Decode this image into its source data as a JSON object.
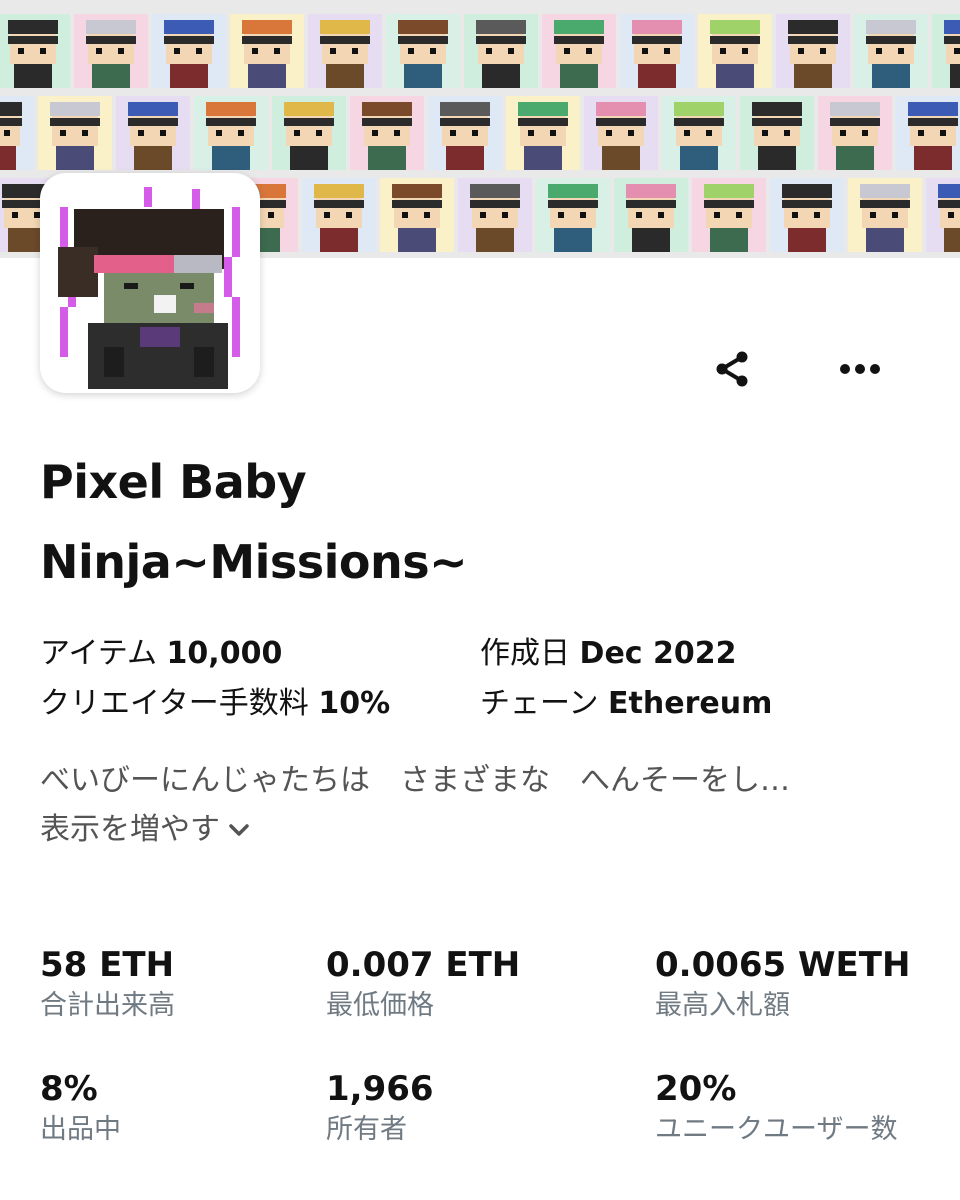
{
  "collection": {
    "title_line1": "Pixel Baby",
    "title_line2": "Ninja~Missions~"
  },
  "actions": {
    "share_icon": "share-icon",
    "more_icon": "more-horizontal-icon"
  },
  "meta": {
    "items_label": "アイテム",
    "items_value": "10,000",
    "created_label": "作成日",
    "created_value": "Dec 2022",
    "fee_label": "クリエイター手数料",
    "fee_value": "10%",
    "chain_label": "チェーン",
    "chain_value": "Ethereum"
  },
  "description": {
    "text": "べいびーにんじゃたちは　さまざまな　へんそーをし…",
    "show_more": "表示を増やす"
  },
  "stats": [
    {
      "value": "58 ETH",
      "label": "合計出来高"
    },
    {
      "value": "0.007 ETH",
      "label": "最低価格"
    },
    {
      "value": "0.0065 WETH",
      "label": "最高入札額"
    },
    {
      "value": "8%",
      "label": "出品中"
    },
    {
      "value": "1,966",
      "label": "所有者"
    },
    {
      "value": "20%",
      "label": "ユニークユーザー数"
    }
  ],
  "colors": {
    "tile_backgrounds": [
      "#cfeedd",
      "#f7d6e4",
      "#dfe9f5",
      "#fbf1c9",
      "#e7ddf3",
      "#d9f0e6"
    ],
    "text_primary": "#121212",
    "text_secondary": "#707a83"
  }
}
